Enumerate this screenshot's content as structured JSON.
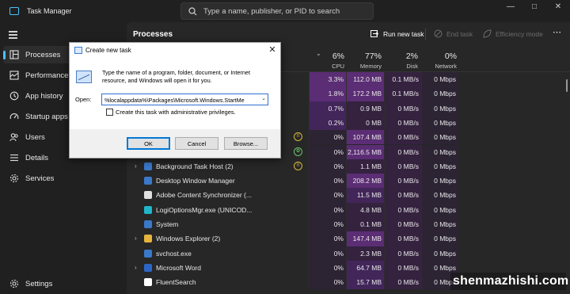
{
  "app": {
    "title": "Task Manager"
  },
  "search": {
    "placeholder": "Type a name, publisher, or PID to search"
  },
  "sidebar": {
    "items": [
      {
        "label": "Processes",
        "icon": "processes-grid-icon"
      },
      {
        "label": "Performance",
        "icon": "performance-chart-icon"
      },
      {
        "label": "App history",
        "icon": "history-clock-icon"
      },
      {
        "label": "Startup apps",
        "icon": "speedometer-icon"
      },
      {
        "label": "Users",
        "icon": "users-icon"
      },
      {
        "label": "Details",
        "icon": "details-list-icon"
      },
      {
        "label": "Services",
        "icon": "gear-icon"
      }
    ],
    "settings_label": "Settings"
  },
  "toolbar": {
    "title": "Processes",
    "run_new_task": "Run new task",
    "end_task": "End task",
    "efficiency_mode": "Efficiency mode"
  },
  "columns": {
    "cpu": {
      "pct": "6%",
      "name": "CPU"
    },
    "memory": {
      "pct": "77%",
      "name": "Memory"
    },
    "disk": {
      "pct": "2%",
      "name": "Disk"
    },
    "network": {
      "pct": "0%",
      "name": "Network"
    }
  },
  "rows": [
    {
      "name": "",
      "expand": false,
      "status": "",
      "cpu": "3.3%",
      "memory": "112.0 MB",
      "disk": "0.1 MB/s",
      "network": "0 Mbps",
      "icon_color": ""
    },
    {
      "name": "",
      "expand": false,
      "status": "",
      "cpu": "1.8%",
      "memory": "172.2 MB",
      "disk": "0.1 MB/s",
      "network": "0 Mbps",
      "icon_color": ""
    },
    {
      "name": "",
      "expand": false,
      "status": "",
      "cpu": "0.7%",
      "memory": "0.9 MB",
      "disk": "0 MB/s",
      "network": "0 Mbps",
      "icon_color": ""
    },
    {
      "name": "",
      "expand": false,
      "status": "",
      "cpu": "0.2%",
      "memory": "0 MB",
      "disk": "0 MB/s",
      "network": "0 Mbps",
      "icon_color": ""
    },
    {
      "name": "",
      "expand": false,
      "status": "suspended",
      "cpu": "0%",
      "memory": "107.4 MB",
      "disk": "0 MB/s",
      "network": "0 Mbps",
      "icon_color": ""
    },
    {
      "name": "",
      "expand": false,
      "status": "efficiency",
      "cpu": "0%",
      "memory": "2,116.5 MB",
      "disk": "0 MB/s",
      "network": "0 Mbps",
      "icon_color": ""
    },
    {
      "name": "Background Task Host (2)",
      "expand": true,
      "status": "suspended",
      "cpu": "0%",
      "memory": "1.1 MB",
      "disk": "0 MB/s",
      "network": "0 Mbps",
      "icon_color": "#3a78c9"
    },
    {
      "name": "Desktop Window Manager",
      "expand": false,
      "status": "",
      "cpu": "0%",
      "memory": "208.2 MB",
      "disk": "0 MB/s",
      "network": "0 Mbps",
      "icon_color": "#3a78c9"
    },
    {
      "name": "Adobe Content Synchronizer (...",
      "expand": false,
      "status": "",
      "cpu": "0%",
      "memory": "11.5 MB",
      "disk": "0 MB/s",
      "network": "0 Mbps",
      "icon_color": "#e0e0e0"
    },
    {
      "name": "LogiOptionsMgr.exe (UNICOD...",
      "expand": false,
      "status": "",
      "cpu": "0%",
      "memory": "4.8 MB",
      "disk": "0 MB/s",
      "network": "0 Mbps",
      "icon_color": "#1fb6c9"
    },
    {
      "name": "System",
      "expand": false,
      "status": "",
      "cpu": "0%",
      "memory": "0.1 MB",
      "disk": "0 MB/s",
      "network": "0 Mbps",
      "icon_color": "#3a78c9"
    },
    {
      "name": "Windows Explorer (2)",
      "expand": true,
      "status": "",
      "cpu": "0%",
      "memory": "147.4 MB",
      "disk": "0 MB/s",
      "network": "0 Mbps",
      "icon_color": "#e6b43c"
    },
    {
      "name": "svchost.exe",
      "expand": false,
      "status": "",
      "cpu": "0%",
      "memory": "2.3 MB",
      "disk": "0 MB/s",
      "network": "0 Mbps",
      "icon_color": "#3a78c9"
    },
    {
      "name": "Microsoft Word",
      "expand": true,
      "status": "",
      "cpu": "0%",
      "memory": "64.7 MB",
      "disk": "0 MB/s",
      "network": "0 Mbps",
      "icon_color": "#2b66c7"
    },
    {
      "name": "FluentSearch",
      "expand": false,
      "status": "",
      "cpu": "0%",
      "memory": "15.7 MB",
      "disk": "0 MB/s",
      "network": "0 Mbps",
      "icon_color": "#ffffff"
    }
  ],
  "dialog": {
    "title": "Create new task",
    "description": "Type the name of a program, folder, document, or Internet resource, and Windows will open it for you.",
    "open_label": "Open:",
    "open_value": "%localappdata%\\Packages\\Microsoft.Windows.StartMe",
    "admin_checkbox": "Create this task with administrative privileges.",
    "admin_checked": false,
    "ok": "OK",
    "cancel": "Cancel",
    "browse": "Browse..."
  },
  "watermark": "shenmazhishi.com",
  "colors": {
    "accent": "#4cc2ff",
    "heat_high": "#5b2d74",
    "heat_mid": "#42265a",
    "heat_low": "#34223f",
    "heat_none": "#2c2333"
  }
}
